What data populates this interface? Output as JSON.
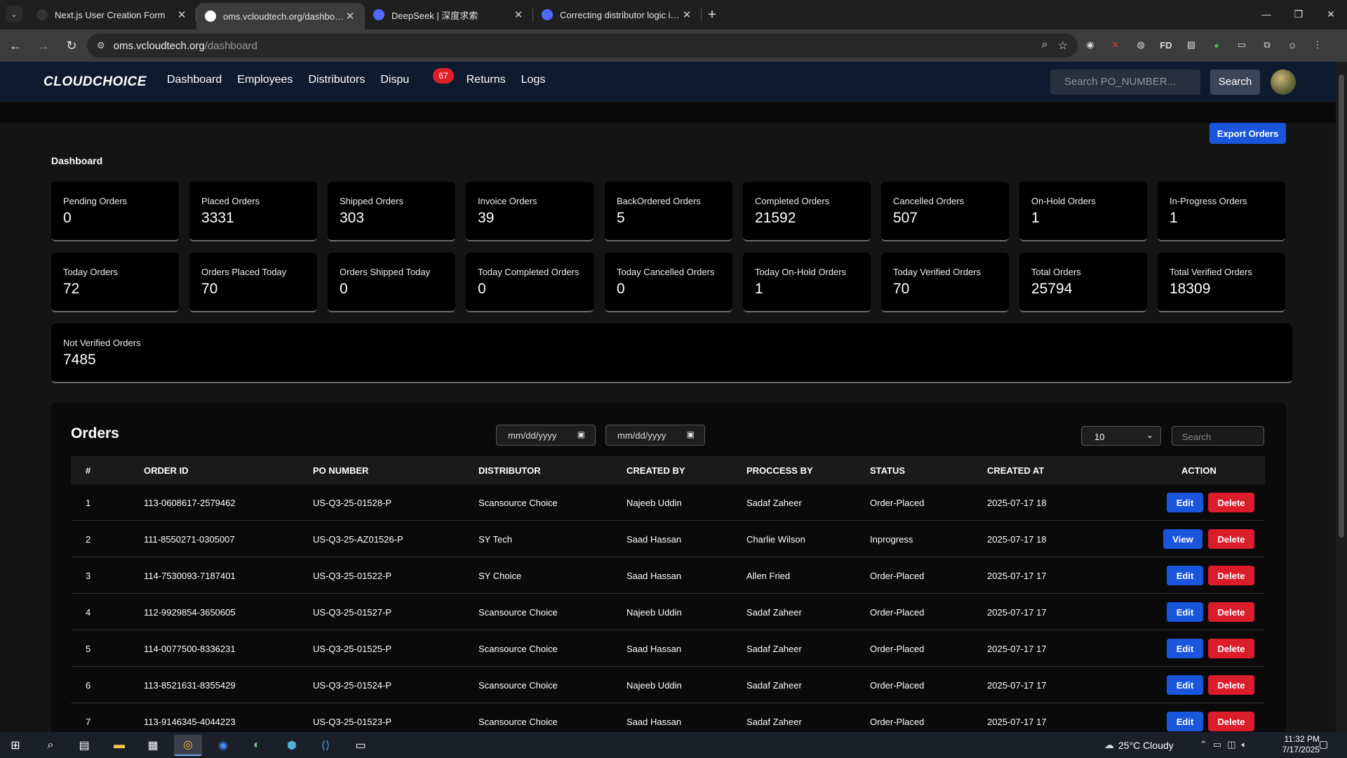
{
  "browser": {
    "tabs": [
      {
        "title": "Next.js User Creation Form",
        "active": false
      },
      {
        "title": "oms.vcloudtech.org/dashboard",
        "active": true
      },
      {
        "title": "DeepSeek | 深度求索",
        "active": false
      },
      {
        "title": "Correcting distributor logic in J",
        "active": false
      }
    ],
    "url_host": "oms.vcloudtech.org",
    "url_path": "/dashboard"
  },
  "appnav": {
    "logo": "CLOUDCHOICE",
    "links": [
      "Dashboard",
      "Employees",
      "Distributors",
      "Dispu",
      "Returns",
      "Logs"
    ],
    "disputes_badge": "67",
    "search_placeholder": "Search PO_NUMBER...",
    "search_button": "Search"
  },
  "dashboard": {
    "export_button": "Export Orders",
    "title": "Dashboard",
    "cards_row1": [
      {
        "label": "Pending Orders",
        "value": "0"
      },
      {
        "label": "Placed Orders",
        "value": "3331"
      },
      {
        "label": "Shipped Orders",
        "value": "303"
      },
      {
        "label": "Invoice Orders",
        "value": "39"
      },
      {
        "label": "BackOrdered Orders",
        "value": "5"
      },
      {
        "label": "Completed Orders",
        "value": "21592"
      },
      {
        "label": "Cancelled Orders",
        "value": "507"
      },
      {
        "label": "On-Hold Orders",
        "value": "1"
      },
      {
        "label": "In-Progress Orders",
        "value": "1"
      }
    ],
    "cards_row2": [
      {
        "label": "Today Orders",
        "value": "72"
      },
      {
        "label": "Orders Placed Today",
        "value": "70"
      },
      {
        "label": "Orders Shipped Today",
        "value": "0"
      },
      {
        "label": "Today Completed Orders",
        "value": "0"
      },
      {
        "label": "Today Cancelled Orders",
        "value": "0"
      },
      {
        "label": "Today On-Hold Orders",
        "value": "1"
      },
      {
        "label": "Today Verified Orders",
        "value": "70"
      },
      {
        "label": "Total Orders",
        "value": "25794"
      },
      {
        "label": "Total Verified Orders",
        "value": "18309"
      }
    ],
    "not_verified": {
      "label": "Not Verified Orders",
      "value": "7485"
    }
  },
  "orders": {
    "title": "Orders",
    "date_placeholder": "mm/dd/yyyy",
    "per_page": "10",
    "search_placeholder": "Search",
    "columns": [
      "#",
      "ORDER ID",
      "PO NUMBER",
      "DISTRIBUTOR",
      "CREATED BY",
      "PROCCESS BY",
      "STATUS",
      "CREATED AT",
      "ACTION"
    ],
    "rows": [
      {
        "n": "1",
        "order_id": "113-0608617-2579462",
        "po": "US-Q3-25-01528-P",
        "distributor": "Scansource Choice",
        "created_by": "Najeeb Uddin",
        "process_by": "Sadaf Zaheer",
        "status": "Order-Placed",
        "created_at": "2025-07-17 18",
        "primary": "Edit"
      },
      {
        "n": "2",
        "order_id": "111-8550271-0305007",
        "po": "US-Q3-25-AZ01526-P",
        "distributor": "SY Tech",
        "created_by": "Saad Hassan",
        "process_by": "Charlie Wilson",
        "status": "Inprogress",
        "created_at": "2025-07-17 18",
        "primary": "View"
      },
      {
        "n": "3",
        "order_id": "114-7530093-7187401",
        "po": "US-Q3-25-01522-P",
        "distributor": "SY Choice",
        "created_by": "Saad Hassan",
        "process_by": "Allen Fried",
        "status": "Order-Placed",
        "created_at": "2025-07-17 17",
        "primary": "Edit"
      },
      {
        "n": "4",
        "order_id": "112-9929854-3650605",
        "po": "US-Q3-25-01527-P",
        "distributor": "Scansource Choice",
        "created_by": "Najeeb Uddin",
        "process_by": "Sadaf Zaheer",
        "status": "Order-Placed",
        "created_at": "2025-07-17 17",
        "primary": "Edit"
      },
      {
        "n": "5",
        "order_id": "114-0077500-8336231",
        "po": "US-Q3-25-01525-P",
        "distributor": "Scansource Choice",
        "created_by": "Saad Hassan",
        "process_by": "Sadaf Zaheer",
        "status": "Order-Placed",
        "created_at": "2025-07-17 17",
        "primary": "Edit"
      },
      {
        "n": "6",
        "order_id": "113-8521631-8355429",
        "po": "US-Q3-25-01524-P",
        "distributor": "Scansource Choice",
        "created_by": "Najeeb Uddin",
        "process_by": "Sadaf Zaheer",
        "status": "Order-Placed",
        "created_at": "2025-07-17 17",
        "primary": "Edit"
      },
      {
        "n": "7",
        "order_id": "113-9146345-4044223",
        "po": "US-Q3-25-01523-P",
        "distributor": "Scansource Choice",
        "created_by": "Saad Hassan",
        "process_by": "Sadaf Zaheer",
        "status": "Order-Placed",
        "created_at": "2025-07-17 17",
        "primary": "Edit"
      }
    ],
    "delete_label": "Delete"
  },
  "taskbar": {
    "weather": "25°C  Cloudy",
    "time": "11:32 PM",
    "date": "7/17/2025"
  },
  "colors": {
    "accent": "#1a56db",
    "danger": "#dc1c2b",
    "nav_bg": "#0e1a2d",
    "badge": "#e11d2a"
  }
}
